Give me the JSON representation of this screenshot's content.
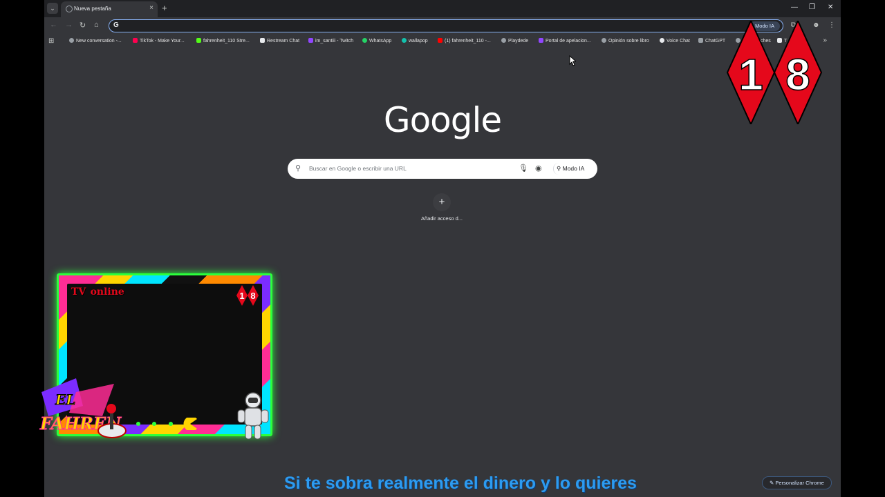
{
  "tabs": [
    {
      "title": "Nueva pestaña",
      "close": "×"
    }
  ],
  "new_tab_symbol": "+",
  "toolbar": {
    "omnibox_value": "",
    "omnibox_icon": "G",
    "modo_ia_label": "Modo IA"
  },
  "bookmarks": [
    {
      "label": "New conversation -...",
      "color": "#9aa0a6"
    },
    {
      "label": "TikTok - Make Your...",
      "color": "#ff0050"
    },
    {
      "label": "fahrenheit_110 Stre...",
      "color": "#53fc18"
    },
    {
      "label": "Restream Chat",
      "color": "#e8eaed"
    },
    {
      "label": "im_santiii - Twitch",
      "color": "#9146ff"
    },
    {
      "label": "WhatsApp",
      "color": "#25d366"
    },
    {
      "label": "wallapop",
      "color": "#13c1ac"
    },
    {
      "label": "(1) fahrenheit_110 -...",
      "color": "#ff0000"
    },
    {
      "label": "Playdede",
      "color": "#9aa0a6"
    },
    {
      "label": "Portal de apelacion...",
      "color": "#9146ff"
    },
    {
      "label": "Opinión sobre libro",
      "color": "#9aa0a6"
    },
    {
      "label": "Voice Chat",
      "color": "#e8eaed"
    },
    {
      "label": "ChatGPT",
      "color": "#9aa0a6"
    },
    {
      "label": "ches",
      "color": "#9aa0a6"
    },
    {
      "label": "T",
      "color": "#e8eaed"
    }
  ],
  "logo_text": "Google",
  "search": {
    "placeholder": "Buscar en Google o escribir una URL",
    "modo_ia": "Modo IA"
  },
  "shortcut": {
    "symbol": "+",
    "label": "Añadir acceso d..."
  },
  "customize_label": "Personalizar Chrome",
  "overlay": {
    "badge_digits": [
      "1",
      "8"
    ],
    "tv_title": "TV",
    "tv_subtitle": "online",
    "logo_text": [
      "EL",
      "FAHREN"
    ],
    "ticker": "Si te sobra realmente el dinero y lo quieres"
  }
}
